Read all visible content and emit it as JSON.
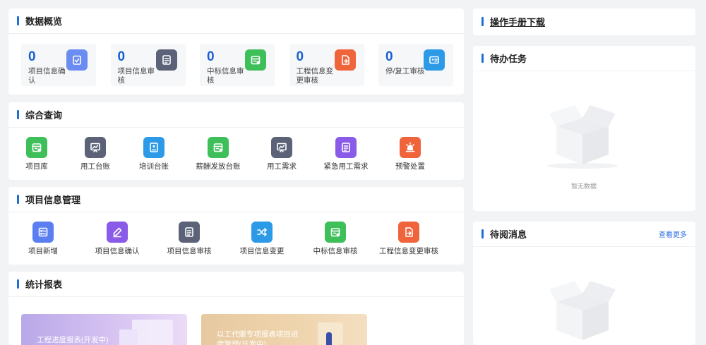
{
  "overview": {
    "title": "数据概览",
    "stats": [
      {
        "value": "0",
        "label": "项目信息确认",
        "icon": "clipboard-check-icon",
        "color": "#6b8cf0"
      },
      {
        "value": "0",
        "label": "项目信息审核",
        "icon": "document-icon",
        "color": "#5c6378"
      },
      {
        "value": "0",
        "label": "中标信息审核",
        "icon": "calendar-icon",
        "color": "#3fbf5a"
      },
      {
        "value": "0",
        "label": "工程信息变更审核",
        "icon": "file-arrow-icon",
        "color": "#f0643c"
      },
      {
        "value": "0",
        "label": "停/复工审核",
        "icon": "id-card-icon",
        "color": "#2d9ae8"
      }
    ]
  },
  "query": {
    "title": "综合查询",
    "items": [
      {
        "label": "项目库",
        "icon": "calendar-icon",
        "color": "#3fbf5a"
      },
      {
        "label": "用工台账",
        "icon": "chart-board-icon",
        "color": "#5c6378"
      },
      {
        "label": "培训台账",
        "icon": "person-card-icon",
        "color": "#2d9ae8"
      },
      {
        "label": "薪酬发放台账",
        "icon": "calendar-icon",
        "color": "#3fbf5a"
      },
      {
        "label": "用工需求",
        "icon": "chart-board-icon",
        "color": "#5c6378"
      },
      {
        "label": "紧急用工需求",
        "icon": "document-icon",
        "color": "#8a5ae8"
      },
      {
        "label": "预警处置",
        "icon": "alarm-icon",
        "color": "#f0643c"
      }
    ]
  },
  "manage": {
    "title": "项目信息管理",
    "items": [
      {
        "label": "项目新增",
        "icon": "checklist-icon",
        "color": "#5b7ff0"
      },
      {
        "label": "项目信息确认",
        "icon": "pencil-icon",
        "color": "#8a5ae8"
      },
      {
        "label": "项目信息审核",
        "icon": "document-icon",
        "color": "#5c6378"
      },
      {
        "label": "项目信息变更",
        "icon": "shuffle-icon",
        "color": "#2d9ae8"
      },
      {
        "label": "中标信息审核",
        "icon": "calendar-icon",
        "color": "#3fbf5a"
      },
      {
        "label": "工程信息变更审核",
        "icon": "file-arrow-icon",
        "color": "#f0643c"
      }
    ]
  },
  "reports": {
    "title": "统计报表",
    "banners": [
      {
        "text": "工程进度报表(开发中)"
      },
      {
        "text": "以工代赈专项报表项目进度管理(开发中)"
      }
    ]
  },
  "manual": {
    "title": "操作手册下载"
  },
  "todo": {
    "title": "待办任务",
    "empty": "暂无数据"
  },
  "messages": {
    "title": "待阅消息",
    "more": "查看更多"
  }
}
